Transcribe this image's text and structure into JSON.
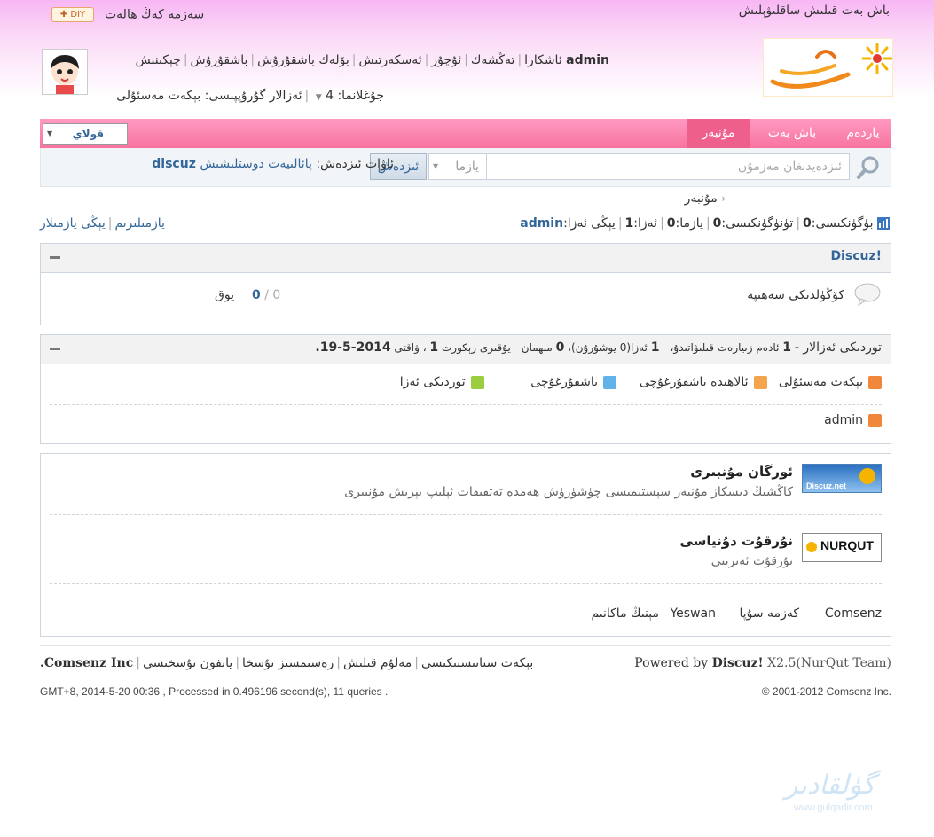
{
  "topbar": {
    "right_links": "باش بەت قىلىش ساقلىۋېلىش",
    "diy": "DIY",
    "left_links": "سەزمە  كەڭ ھالەت"
  },
  "user": {
    "name": "admin",
    "menu": [
      "ئاشكارا",
      "تەڭشەك",
      "ئۇچۇر",
      "ئەسكەرتىش",
      "بۆلەك باشقۇرۇش",
      "باشقۇرۇش",
      "چېكىنىش"
    ],
    "points_label": "جۇغلانما:",
    "points_value": "4",
    "group_label": "ئەزالار گۇرۇپپىسى:",
    "group_value": "بېكەت مەسئۇلى"
  },
  "nav": {
    "items": [
      "ياردەم",
      "باش بەت",
      "مۇنبەر"
    ],
    "active_index": 2,
    "lang_select": "قولاي"
  },
  "search": {
    "placeholder": "ئىزدەيدىغان مەزمۇن",
    "category": "يازما",
    "button": "ئىزدەش",
    "hot_label": "ئاۋات ئىزدەش:",
    "hot_items": [
      "پائالىيەت",
      "دوستلىشىش",
      "discuz"
    ]
  },
  "breadcrumb": {
    "current": "مۇنبەر"
  },
  "stats": {
    "today_label": "بۈگۈنكىسى:",
    "today": "0",
    "yesterday_label": "تۈنۈگۈنكىسى:",
    "yesterday": "0",
    "posts_label": "يازما:",
    "posts": "0",
    "members_label": "ئەزا:",
    "members": "1",
    "newest_label": "يېڭى ئەزا:",
    "newest": "admin",
    "my_posts": "يازمىلىرىم",
    "new_posts": "يېڭى يازمىلار"
  },
  "discuz_box": {
    "title": "Discuz!",
    "forum_name": "كۆڭۈلدىكى سەھىپە",
    "count_a": "0",
    "count_slash": "/",
    "count_b": "0",
    "last": "يوق"
  },
  "online_box": {
    "title_prefix": "توردىكى ئەزالار -",
    "title_members": "1",
    "title_mid": "ئادەم زىيارەت قىلىۋاتىدۇ، -",
    "title_member_count": "1",
    "title_invisible": "ئەزا(0 يوشۇرۇن)،",
    "title_guests": "0",
    "title_guests_label": "مېھمان -",
    "title_record_label": "يۇقىرى رېكورت",
    "title_record": "1",
    "title_time_label": "، ۋاقتى",
    "title_date": "2014-5-19.",
    "legend": [
      {
        "label": "بېكەت مەسئۇلى",
        "color": "#f0883c"
      },
      {
        "label": "ئالاھىدە باشقۇرغۇچى",
        "color": "#f4a44c"
      },
      {
        "label": "باشقۇرغۇچى",
        "color": "#5fb3e6"
      },
      {
        "label": "توردىكى ئەزا",
        "color": "#9ccd3e"
      }
    ],
    "online_user": "admin"
  },
  "links_box": {
    "items": [
      {
        "title": "ئورگان مۇنبىرى",
        "desc": "كاڭشىڭ دىسكاز مۇنبەر سېستىمىسى چۈشۈرۈش ھەمدە تەتقىقات ئېلىپ بېرىش مۇنبىرى",
        "logo": "Discuz.net"
      },
      {
        "title": "نۇرقۇت دۇنياسى",
        "desc": "نۇرقۇت ئەترىتى",
        "logo": "NURQUT"
      }
    ],
    "text_links": [
      "Comsenz",
      "كەزمە سۇپا",
      "Yeswan",
      "مېنىڭ ماكانىم"
    ]
  },
  "footer": {
    "powered_by": "Powered by",
    "brand": "Discuz!",
    "version": "X2.5(NurQut Team)",
    "links": [
      "بېكەت ستاتىستىكىسى",
      "مەلۇم قىلىش",
      "رەسىمسىز نۇسخا",
      "يانفون نۇسخىسى",
      "Comsenz Inc."
    ],
    "copyright": "© 2001-2012 Comsenz Inc.",
    "processed": "GMT+8, 2014-5-20 00:36 , Processed in 0.496196 second(s), 11 queries ."
  },
  "watermark": {
    "text": "گۈلقادىر",
    "sub": "www.gulqadir.com"
  },
  "colors": {
    "nav": "#f7739f",
    "nav_active": "#ef5f8c",
    "link": "#336699"
  }
}
